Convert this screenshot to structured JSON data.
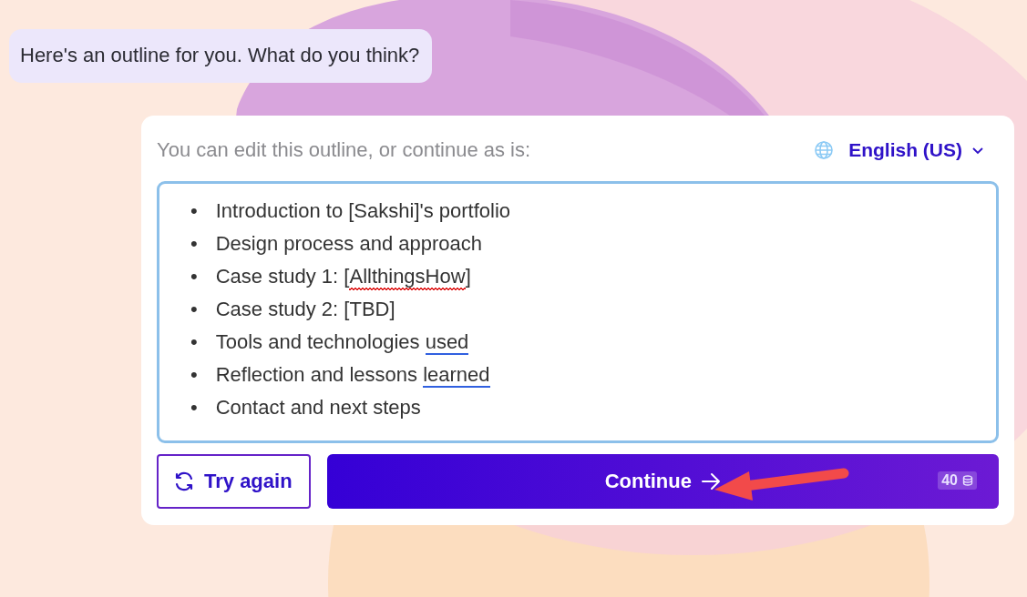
{
  "chat_bubble": {
    "text": "Here's an outline for you. What do you think?"
  },
  "outline_card": {
    "prompt": "You can edit this outline, or continue as is:",
    "language": {
      "label": "English (US)"
    },
    "items": [
      {
        "bullet": "•",
        "parts": [
          {
            "text": "Introduction to [Sakshi]'s portfolio",
            "spell_error": false,
            "grammar_error": false
          }
        ]
      },
      {
        "bullet": "•",
        "parts": [
          {
            "text": "Design process and approach",
            "spell_error": false,
            "grammar_error": false
          }
        ]
      },
      {
        "bullet": "•",
        "parts": [
          {
            "text": "Case study 1: [",
            "spell_error": false,
            "grammar_error": false
          },
          {
            "text": "AllthingsHow",
            "spell_error": true,
            "grammar_error": false
          },
          {
            "text": "]",
            "spell_error": false,
            "grammar_error": false
          }
        ]
      },
      {
        "bullet": "•",
        "parts": [
          {
            "text": "Case study 2: [TBD]",
            "spell_error": false,
            "grammar_error": false
          }
        ]
      },
      {
        "bullet": "•",
        "parts": [
          {
            "text": "Tools and technologies ",
            "spell_error": false,
            "grammar_error": false
          },
          {
            "text": "used",
            "spell_error": false,
            "grammar_error": true
          }
        ]
      },
      {
        "bullet": "•",
        "parts": [
          {
            "text": "Reflection and lessons ",
            "spell_error": false,
            "grammar_error": false
          },
          {
            "text": "learned",
            "spell_error": false,
            "grammar_error": true
          }
        ]
      },
      {
        "bullet": "•",
        "parts": [
          {
            "text": "Contact and next steps",
            "spell_error": false,
            "grammar_error": false
          }
        ]
      }
    ],
    "buttons": [
      {
        "kind": "retry",
        "label": "Try again"
      },
      {
        "kind": "continue",
        "label": "Continue",
        "cost": "40"
      }
    ]
  },
  "overlays": [
    {
      "kind": "arrow"
    }
  ]
}
